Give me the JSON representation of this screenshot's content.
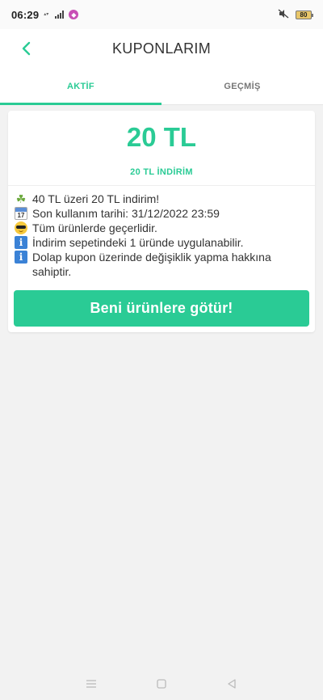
{
  "status_bar": {
    "time": "06:29",
    "battery": "80"
  },
  "header": {
    "title": "KUPONLARIM"
  },
  "tabs": [
    {
      "label": "AKTİF",
      "active": true
    },
    {
      "label": "GEÇMİŞ",
      "active": false
    }
  ],
  "coupon": {
    "amount": "20 TL",
    "subtitle": "20 TL İNDİRİM",
    "calendar_icon_day": "17",
    "details": [
      {
        "icon": "clover-icon",
        "text": "40 TL üzeri 20 TL indirim!"
      },
      {
        "icon": "calendar-icon",
        "text": "Son kullanım tarihi: 31/12/2022 23:59"
      },
      {
        "icon": "sunglasses-icon",
        "text": "Tüm ürünlerde geçerlidir."
      },
      {
        "icon": "info-icon",
        "text": "İndirim sepetindeki 1 üründe uygulanabilir."
      },
      {
        "icon": "info-icon",
        "text": "Dolap kupon üzerinde değişiklik yapma hakkına sahiptir."
      }
    ],
    "cta_label": "Beni ürünlere götür!"
  },
  "colors": {
    "accent": "#2acb95",
    "background": "#f2f2f2",
    "card": "#ffffff"
  }
}
